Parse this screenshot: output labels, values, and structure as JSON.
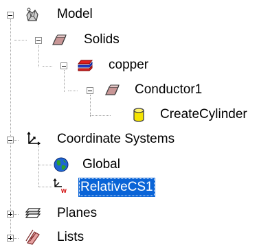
{
  "tree": {
    "model": {
      "label": "Model",
      "icon": "model-icon",
      "state": "expanded"
    },
    "solids": {
      "label": "Solids",
      "icon": "solids-icon",
      "state": "expanded"
    },
    "copper": {
      "label": "copper",
      "icon": "material-icon",
      "state": "expanded"
    },
    "conductor1": {
      "label": "Conductor1",
      "icon": "solid-object-icon",
      "state": "expanded"
    },
    "create_cylinder": {
      "label": "CreateCylinder",
      "icon": "cylinder-icon"
    },
    "coordinate_systems": {
      "label": "Coordinate Systems",
      "icon": "axes-icon",
      "state": "expanded"
    },
    "global": {
      "label": "Global",
      "icon": "globe-icon"
    },
    "relative_cs1": {
      "label": "RelativeCS1",
      "icon": "relative-cs-icon",
      "selected": true
    },
    "planes": {
      "label": "Planes",
      "icon": "planes-icon",
      "state": "collapsed"
    },
    "lists": {
      "label": "Lists",
      "icon": "lists-icon",
      "state": "collapsed"
    }
  },
  "colors": {
    "selection_bg": "#0a64d7",
    "selection_text": "#ffffff",
    "connector": "#a0a0a0",
    "cylinder_fill": "#f5e400",
    "solid_fill": "#c89696",
    "material_red": "#e02020",
    "material_blue": "#2040e0",
    "relative_cs_red": "#d00000"
  }
}
